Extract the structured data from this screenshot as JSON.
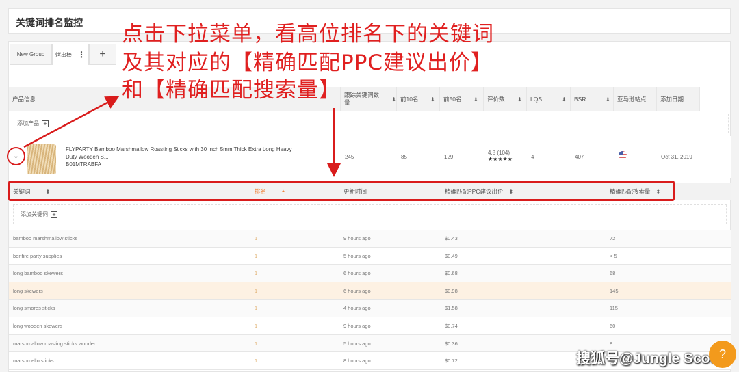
{
  "title": "关键词排名监控",
  "tabs": [
    {
      "label": "New Group"
    },
    {
      "label": "烤串棒"
    },
    {
      "label": "+"
    }
  ],
  "product_table": {
    "headers": [
      "产品信息",
      "跟踪关键词数量",
      "前10名",
      "前50名",
      "评价数",
      "LQS",
      "BSR",
      "亚马逊站点",
      "添加日期"
    ],
    "add_product": "添加产品",
    "product": {
      "title_line1": "FLYPARTY Bamboo Marshmallow Roasting Sticks with 30 Inch 5mm Thick Extra Long Heavy",
      "title_line2": "Duty Wooden S...",
      "asin": "B01MTRABFA",
      "tracked": "245",
      "top10": "85",
      "top50": "129",
      "rating": "4.8 (104)",
      "stars": "★★★★★",
      "lqs": "4",
      "bsr": "407",
      "marketplace_icon": "us-flag-icon",
      "date": "Oct 31, 2019"
    }
  },
  "keyword_table": {
    "headers": [
      "关键词",
      "排名",
      "更新时间",
      "精确匹配PPC建议出价",
      "精确匹配搜索量"
    ],
    "add_keyword": "添加关键词",
    "rows": [
      {
        "keyword": "bamboo marshmallow sticks",
        "rank": "1",
        "updated": "9 hours ago",
        "ppc": "$0.43",
        "volume": "72"
      },
      {
        "keyword": "bonfire party supplies",
        "rank": "1",
        "updated": "5 hours ago",
        "ppc": "$0.49",
        "volume": "< 5"
      },
      {
        "keyword": "long bamboo skewers",
        "rank": "1",
        "updated": "6 hours ago",
        "ppc": "$0.68",
        "volume": "68"
      },
      {
        "keyword": "long skewers",
        "rank": "1",
        "updated": "6 hours ago",
        "ppc": "$0.98",
        "volume": "145"
      },
      {
        "keyword": "long smores sticks",
        "rank": "1",
        "updated": "4 hours ago",
        "ppc": "$1.58",
        "volume": "115"
      },
      {
        "keyword": "long wooden skewers",
        "rank": "1",
        "updated": "9 hours ago",
        "ppc": "$0.74",
        "volume": "60"
      },
      {
        "keyword": "marshmallow roasting sticks wooden",
        "rank": "1",
        "updated": "5 hours ago",
        "ppc": "$0.36",
        "volume": "8"
      },
      {
        "keyword": "marshmello sticks",
        "rank": "1",
        "updated": "8 hours ago",
        "ppc": "$0.72",
        "volume": ""
      }
    ]
  },
  "annotation": {
    "line1": "点击下拉菜单，看高位排名下的关键词",
    "line2": "及其对应的【精确匹配PPC建议出价】",
    "line3": "和【精确匹配搜索量】"
  },
  "watermark": "搜狐号@Jungle Scout",
  "help_icon": "?",
  "colors": {
    "accent": "#f39a1c",
    "annotation": "#e02020",
    "rank_sorted": "#f0843c"
  }
}
